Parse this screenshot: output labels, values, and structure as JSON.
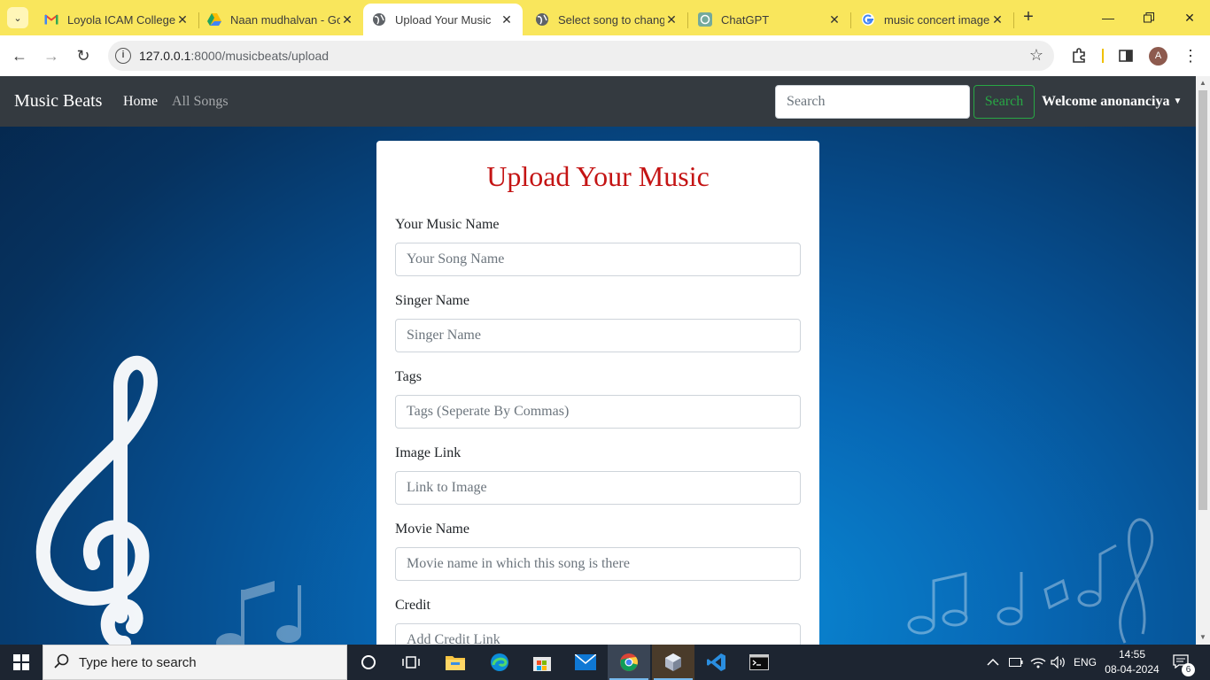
{
  "browser": {
    "tabs": [
      {
        "title": "Loyola ICAM College",
        "icon": "gmail-icon",
        "active": false
      },
      {
        "title": "Naan mudhalvan - Go",
        "icon": "drive-icon",
        "active": false
      },
      {
        "title": "Upload Your Music",
        "icon": "globe-icon",
        "active": true
      },
      {
        "title": "Select song to chang",
        "icon": "globe-icon",
        "active": false
      },
      {
        "title": "ChatGPT",
        "icon": "chatgpt-icon",
        "active": false
      },
      {
        "title": "music concert image",
        "icon": "google-icon",
        "active": false
      }
    ],
    "url_host": "127.0.0.1",
    "url_path": ":8000/musicbeats/upload",
    "profile_initial": "A"
  },
  "navbar": {
    "brand": "Music Beats",
    "links": {
      "home": "Home",
      "all_songs": "All Songs"
    },
    "search_placeholder": "Search",
    "search_button": "Search",
    "user_menu": "Welcome anonanciya"
  },
  "form": {
    "heading": "Upload Your Music",
    "fields": [
      {
        "label": "Your Music Name",
        "placeholder": "Your Song Name"
      },
      {
        "label": "Singer Name",
        "placeholder": "Singer Name"
      },
      {
        "label": "Tags",
        "placeholder": "Tags (Seperate By Commas)"
      },
      {
        "label": "Image Link",
        "placeholder": "Link to Image"
      },
      {
        "label": "Movie Name",
        "placeholder": "Movie name in which this song is there"
      },
      {
        "label": "Credit",
        "placeholder": "Add Credit Link"
      }
    ]
  },
  "taskbar": {
    "search_placeholder": "Type here to search",
    "language": "ENG",
    "time": "14:55",
    "date": "08-04-2024",
    "notification_count": "6"
  },
  "colors": {
    "heading": "#c41414",
    "navbar_bg": "#343a40",
    "search_button": "#28a745",
    "tab_strip": "#f9e65c"
  }
}
